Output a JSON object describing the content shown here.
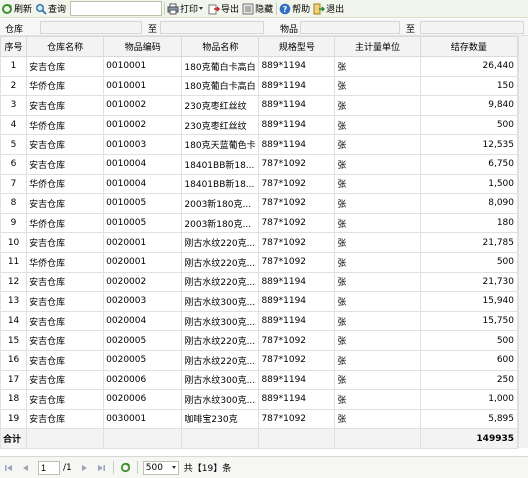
{
  "toolbar": {
    "refresh": "刷新",
    "query": "查询",
    "query_value": "",
    "print": "打印",
    "export": "导出",
    "hide": "隐藏",
    "help": "帮助",
    "exit": "退出"
  },
  "filter": {
    "warehouse_label": "仓库",
    "to_label_1": "至",
    "item_label": "物品",
    "to_label_2": "至"
  },
  "grid": {
    "columns": [
      "序号",
      "仓库名称",
      "物品编码",
      "物品名称",
      "规格型号",
      "主计量单位",
      "结存数量"
    ],
    "rows": [
      [
        "1",
        "安吉仓库",
        "0010001",
        "180克葡白卡高白",
        "889*1194",
        "张",
        "26,440"
      ],
      [
        "2",
        "华侨仓库",
        "0010001",
        "180克葡白卡高白",
        "889*1194",
        "张",
        "150"
      ],
      [
        "3",
        "安吉仓库",
        "0010002",
        "230克枣红丝纹",
        "889*1194",
        "张",
        "9,840"
      ],
      [
        "4",
        "华侨仓库",
        "0010002",
        "230克枣红丝纹",
        "889*1194",
        "张",
        "500"
      ],
      [
        "5",
        "安吉仓库",
        "0010003",
        "180克天蓝葡色卡",
        "889*1194",
        "张",
        "12,535"
      ],
      [
        "6",
        "安吉仓库",
        "0010004",
        "18401BB新18...",
        "787*1092",
        "张",
        "6,750"
      ],
      [
        "7",
        "华侨仓库",
        "0010004",
        "18401BB新18...",
        "787*1092",
        "张",
        "1,500"
      ],
      [
        "8",
        "安吉仓库",
        "0010005",
        "2003新180克...",
        "787*1092",
        "张",
        "8,090"
      ],
      [
        "9",
        "华侨仓库",
        "0010005",
        "2003新180克...",
        "787*1092",
        "张",
        "180"
      ],
      [
        "10",
        "安吉仓库",
        "0020001",
        "刚古水纹220克...",
        "787*1092",
        "张",
        "21,785"
      ],
      [
        "11",
        "华侨仓库",
        "0020001",
        "刚古水纹220克...",
        "787*1092",
        "张",
        "500"
      ],
      [
        "12",
        "安吉仓库",
        "0020002",
        "刚古水纹220克...",
        "889*1194",
        "张",
        "21,730"
      ],
      [
        "13",
        "安吉仓库",
        "0020003",
        "刚古水纹300克...",
        "889*1194",
        "张",
        "15,940"
      ],
      [
        "14",
        "安吉仓库",
        "0020004",
        "刚古水纹300克...",
        "889*1194",
        "张",
        "15,750"
      ],
      [
        "15",
        "安吉仓库",
        "0020005",
        "刚古水纹220克...",
        "787*1092",
        "张",
        "500"
      ],
      [
        "16",
        "安吉仓库",
        "0020005",
        "刚古水纹220克...",
        "787*1092",
        "张",
        "600"
      ],
      [
        "17",
        "安吉仓库",
        "0020006",
        "刚古水纹300克...",
        "889*1194",
        "张",
        "250"
      ],
      [
        "18",
        "安吉仓库",
        "0020006",
        "刚古水纹300克...",
        "889*1194",
        "张",
        "1,000"
      ],
      [
        "19",
        "安吉仓库",
        "0030001",
        "咖啡宝230克",
        "787*1092",
        "张",
        "5,895"
      ]
    ],
    "total_label": "合计",
    "total_value": "149935"
  },
  "pager": {
    "page": "1",
    "page_count": "/1",
    "page_size": "500",
    "summary": "共【19】条"
  }
}
